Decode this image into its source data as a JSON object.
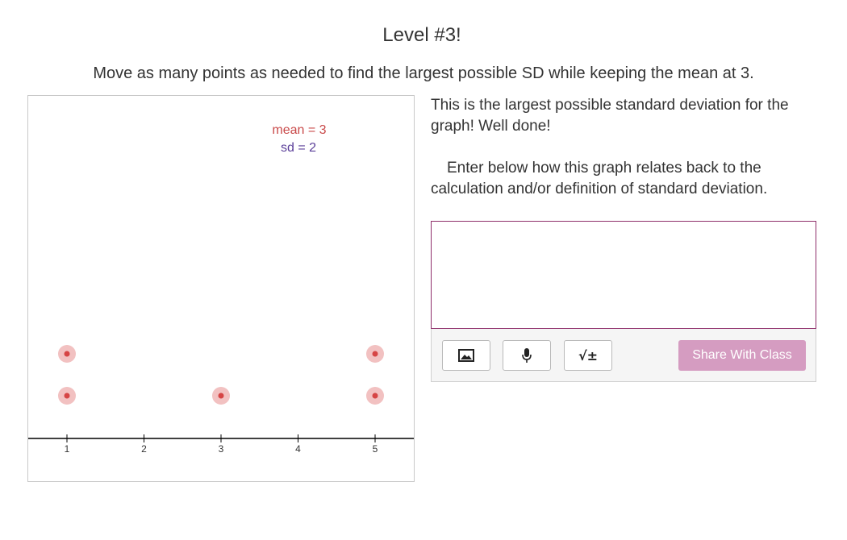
{
  "title": "Level #3!",
  "prompt": "Move as many points as needed to find the largest possible SD while keeping the mean at 3.",
  "graph": {
    "mean_label": "mean = 3",
    "sd_label": "sd = 2",
    "mean_color": "#c94a4a",
    "sd_color": "#5b3f99",
    "point_color": "#d64545",
    "point_halo": "#f2c1c1",
    "ticks": [
      "1",
      "2",
      "3",
      "4",
      "5"
    ]
  },
  "chart_data": {
    "type": "scatter",
    "title": "",
    "xlabel": "",
    "ylabel": "",
    "xlim": [
      1,
      5
    ],
    "points": [
      1,
      1,
      3,
      5,
      5
    ],
    "mean": 3,
    "sd": 2
  },
  "feedback": "This is the largest possible standard deviation for the graph! Well done!",
  "instructions": "Enter below how this graph relates back to the calculation and/or definition of standard deviation.",
  "answer": {
    "value": ""
  },
  "toolbar": {
    "image_icon": "image-icon",
    "mic_icon": "microphone-icon",
    "math_icon": "math-icon",
    "math_glyph": "√±",
    "share_label": "Share With Class",
    "share_color": "#d59cc1"
  }
}
